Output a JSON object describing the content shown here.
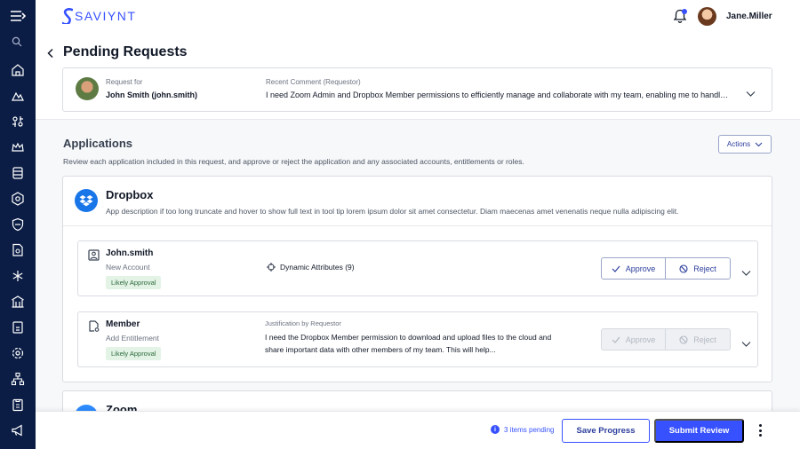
{
  "header": {
    "logo_text": "SAVIYNT",
    "username": "Jane.Miller"
  },
  "page": {
    "title": "Pending Requests"
  },
  "request": {
    "for_label": "Request for",
    "for_value": "John Smith (john.smith)",
    "comment_label": "Recent Comment (Requestor)",
    "comment_value": "I need Zoom Admin and Dropbox Member permissions to efficiently manage and collaborate with my team, enabling me to handle administrative tasks and share files."
  },
  "applications": {
    "title": "Applications",
    "description": "Review each application included in this request, and approve or reject the application and any associated accounts, entitlements or roles.",
    "actions_label": "Actions",
    "apps": [
      {
        "name": "Dropbox",
        "description": "App description if too long truncate and hover to show full text in tool tip lorem ipsum dolor sit amet consectetur. Diam maecenas amet venenatis neque nulla adipiscing elit.",
        "items": [
          {
            "name": "John.smith",
            "type": "New Account",
            "badge": "Likely Approval",
            "detail": "Dynamic Attributes (9)",
            "approve": "Approve",
            "reject": "Reject"
          },
          {
            "name": "Member",
            "type": "Add Entitlement",
            "badge": "Likely Approval",
            "justification_label": "Justification by Requestor",
            "justification": "I need the Dropbox Member permission to download and upload files to the cloud and share important data with other members of my team. This will help...",
            "approve": "Approve",
            "reject": "Reject"
          }
        ]
      },
      {
        "name": "Zoom"
      }
    ]
  },
  "footer": {
    "pending": "3 items pending",
    "save": "Save Progress",
    "submit": "Submit Review"
  },
  "colors": {
    "sidebar": "#0b1d45",
    "primary": "#3751ff",
    "badge_bg": "#e3f3e6"
  }
}
